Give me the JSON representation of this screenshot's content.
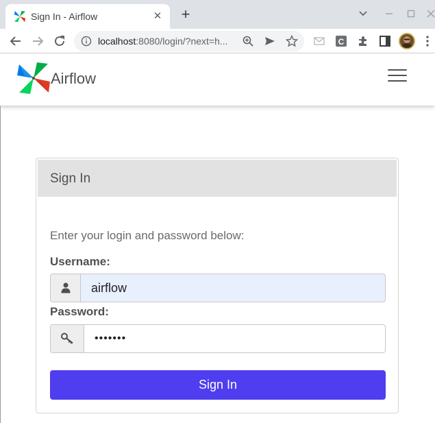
{
  "browser": {
    "tab_title": "Sign In - Airflow",
    "new_tab_glyph": "+",
    "close_glyph": "✕",
    "url_host": "localhost",
    "url_rest": ":8080/login/?next=h...",
    "icons": [
      "back-icon",
      "forward-icon",
      "reload-icon",
      "site-info-icon",
      "zoom-icon",
      "send-icon",
      "bookmark-star-icon",
      "extension-icon",
      "puzzle-icon",
      "side-panel-icon",
      "profile-avatar",
      "menu-icon"
    ]
  },
  "navbar": {
    "brand": "Airflow"
  },
  "login": {
    "title": "Sign In",
    "intro": "Enter your login and password below:",
    "username_label": "Username:",
    "username_value": "airflow",
    "password_label": "Password:",
    "password_value": "•••••••",
    "submit_label": "Sign In"
  },
  "colors": {
    "accent": "#4f3df0",
    "autofill_bg": "#e8f0fe",
    "panel_header": "#e2e2e2",
    "text": "#51504f"
  }
}
